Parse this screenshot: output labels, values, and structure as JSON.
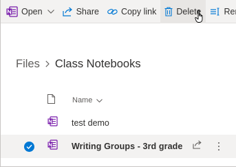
{
  "toolbar": {
    "open_label": "Open",
    "share_label": "Share",
    "copy_link_label": "Copy link",
    "delete_label": "Delete",
    "rename_label": "Rena"
  },
  "breadcrumb": {
    "root": "Files",
    "current": "Class Notebooks"
  },
  "list": {
    "name_column": "Name",
    "files": [
      {
        "name": "test demo",
        "selected": false
      },
      {
        "name": "Writing Groups - 3rd grade",
        "selected": true
      }
    ]
  },
  "colors": {
    "onenote_purple": "#7719aa",
    "accent_blue": "#0078d4",
    "command_bar_bg": "#f3f2f1"
  },
  "icons": [
    "onenote-icon",
    "chevron-down-icon",
    "share-icon",
    "link-icon",
    "trash-icon",
    "rename-icon",
    "mouse-cursor-icon",
    "document-icon",
    "check-icon",
    "more-icon"
  ]
}
